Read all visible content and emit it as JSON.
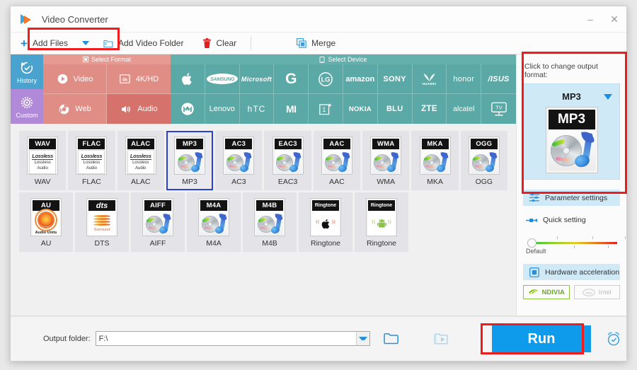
{
  "window": {
    "title": "Video Converter",
    "controls": {
      "minimize": "–",
      "close": "✕"
    }
  },
  "toolbar": {
    "add_files": "Add Files",
    "add_files_caret": "dropdown-caret",
    "add_video_folder": "Add Video Folder",
    "clear": "Clear",
    "merge": "Merge"
  },
  "sidebar": {
    "history": "History",
    "custom": "Custom"
  },
  "categories": {
    "header": "Select Format",
    "items": [
      {
        "label": "Video",
        "icon": "play-circle-icon",
        "selected": false
      },
      {
        "label": "4K/HD",
        "icon": "4k-icon",
        "selected": false
      },
      {
        "label": "Web",
        "icon": "chrome-icon",
        "selected": false
      },
      {
        "label": "Audio",
        "icon": "speaker-icon",
        "selected": true
      }
    ]
  },
  "devices": {
    "header": "Select Device",
    "brands": [
      {
        "name": "Apple",
        "glyph": "",
        "kind": "glyph"
      },
      {
        "name": "SAMSUNG",
        "glyph": "SAMSUNG",
        "kind": "oval"
      },
      {
        "name": "Microsoft",
        "glyph": "Microsoft",
        "kind": "text"
      },
      {
        "name": "Google",
        "glyph": "G",
        "kind": "bigletter"
      },
      {
        "name": "LG",
        "glyph": "LG",
        "kind": "circle"
      },
      {
        "name": "amazon",
        "glyph": "amazon",
        "kind": "text"
      },
      {
        "name": "SONY",
        "glyph": "SONY",
        "kind": "text"
      },
      {
        "name": "HUAWEI",
        "glyph": "HUAWEI",
        "kind": "huawei"
      },
      {
        "name": "honor",
        "glyph": "honor",
        "kind": "text"
      },
      {
        "name": "ASUS",
        "glyph": "/ISUS",
        "kind": "text"
      },
      {
        "name": "Motorola",
        "glyph": "M",
        "kind": "circle"
      },
      {
        "name": "Lenovo",
        "glyph": "Lenovo",
        "kind": "text"
      },
      {
        "name": "HTC",
        "glyph": "hTC",
        "kind": "text"
      },
      {
        "name": "Mi",
        "glyph": "MI",
        "kind": "text"
      },
      {
        "name": "OnePlus",
        "glyph": "1",
        "kind": "square1"
      },
      {
        "name": "NOKIA",
        "glyph": "NOKIA",
        "kind": "text"
      },
      {
        "name": "BLU",
        "glyph": "BLU",
        "kind": "text"
      },
      {
        "name": "ZTE",
        "glyph": "ZTE",
        "kind": "text"
      },
      {
        "name": "alcatel",
        "glyph": "alcatel",
        "kind": "text"
      },
      {
        "name": "TV",
        "glyph": "TV",
        "kind": "tv"
      }
    ]
  },
  "formats": {
    "rows": [
      [
        {
          "label": "WAV",
          "tag": "WAV",
          "art": "lossless",
          "selected": false
        },
        {
          "label": "FLAC",
          "tag": "FLAC",
          "art": "lossless",
          "selected": false
        },
        {
          "label": "ALAC",
          "tag": "ALAC",
          "art": "lossless",
          "selected": false
        },
        {
          "label": "MP3",
          "tag": "MP3",
          "art": "cd",
          "selected": true
        },
        {
          "label": "AC3",
          "tag": "AC3",
          "art": "cd",
          "selected": false
        },
        {
          "label": "EAC3",
          "tag": "EAC3",
          "art": "cd",
          "selected": false
        },
        {
          "label": "AAC",
          "tag": "AAC",
          "art": "cd",
          "selected": false
        },
        {
          "label": "WMA",
          "tag": "WMA",
          "art": "cd",
          "selected": false
        },
        {
          "label": "MKA",
          "tag": "MKA",
          "art": "cd",
          "selected": false
        },
        {
          "label": "OGG",
          "tag": "OGG",
          "art": "cd",
          "selected": false
        }
      ],
      [
        {
          "label": "AU",
          "tag": "AU",
          "art": "au",
          "selected": false
        },
        {
          "label": "DTS",
          "tag": "dts",
          "art": "dts",
          "selected": false
        },
        {
          "label": "AIFF",
          "tag": "AIFF",
          "art": "cd",
          "selected": false
        },
        {
          "label": "M4A",
          "tag": "M4A",
          "art": "cd",
          "selected": false
        },
        {
          "label": "M4B",
          "tag": "M4B",
          "art": "cd",
          "selected": false
        },
        {
          "label": "Ringtone",
          "tag": "Ringtone",
          "art": "ring-ios",
          "selected": false
        },
        {
          "label": "Ringtone",
          "tag": "Ringtone",
          "art": "ring-droid",
          "selected": false
        }
      ]
    ],
    "lossless_word": "Lossless",
    "lossless_line1": "Lossless",
    "lossless_line2": "Audio",
    "au_sub": "Audio Units",
    "dts_sub": "Surround"
  },
  "output_panel": {
    "prompt": "Click to change output format:",
    "format_name": "MP3",
    "format_tag": "MP3",
    "parameter_settings": "Parameter settings",
    "quick_setting": "Quick setting",
    "slider_caption": "Default",
    "hardware_acceleration": "Hardware acceleration",
    "nvidia": "NDIVIA",
    "intel": "Intel"
  },
  "bottom": {
    "output_folder_label": "Output folder:",
    "output_folder_value": "F:\\",
    "browse_icon": "folder-icon",
    "open_icon": "open-output-icon",
    "run_label": "Run",
    "alarm_icon": "alarm-clock-icon"
  },
  "colors": {
    "accent_blue": "#0f9bec",
    "highlight_red": "#ee1c1c",
    "selected_border": "#2b3fd0",
    "history_tile": "#4aa3ce",
    "custom_tile": "#b08ad8",
    "format_tile": "#e08d86",
    "format_tile_selected": "#d4726b",
    "device_tile": "#5aa9a6",
    "panel_card": "#cfe9f7",
    "nvidia_green": "#6aa62c"
  }
}
